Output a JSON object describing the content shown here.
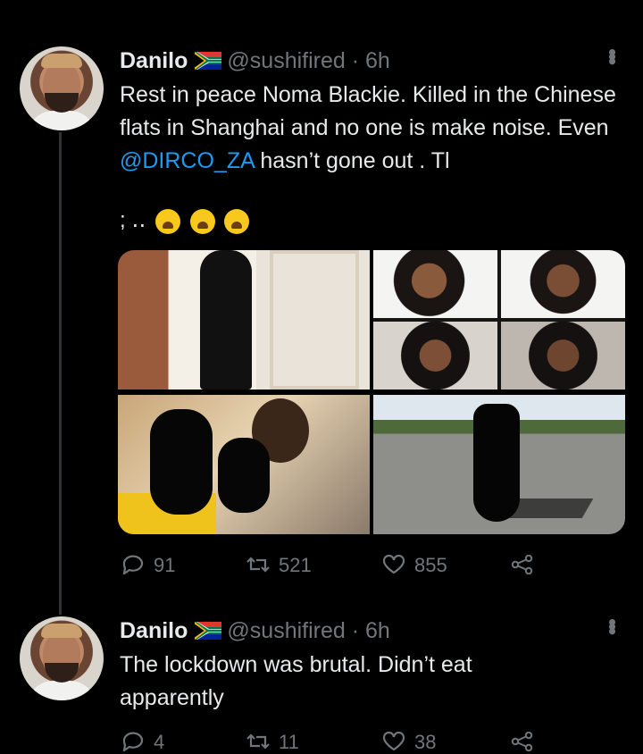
{
  "thread": [
    {
      "author": {
        "name": "Danilo",
        "handle": "@sushifired",
        "flag": "south-africa-flag-icon"
      },
      "separator": "·",
      "time": "6h",
      "text_part1": "Rest in peace Noma Blackie. Killed in the Chinese flats in Shanghai and no one is make noise. Even ",
      "mention": "@DIRCO_ZA",
      "text_part2": " hasn’t gone out . Tl",
      "emoji_line_prefix": ";  ‥",
      "emojis": [
        "loudly-crying-face",
        "loudly-crying-face",
        "loudly-crying-face"
      ],
      "media_count": 4,
      "stats": {
        "replies": "91",
        "retweets": "521",
        "likes": "855"
      }
    },
    {
      "author": {
        "name": "Danilo",
        "handle": "@sushifired",
        "flag": "south-africa-flag-icon"
      },
      "separator": "·",
      "time": "6h",
      "text": "The lockdown was brutal. Didn’t eat apparently",
      "stats": {
        "replies": "4",
        "retweets": "11",
        "likes": "38"
      }
    }
  ],
  "colors": {
    "background": "#000000",
    "text": "#e7e9ea",
    "secondary": "#71767b",
    "link": "#1d9bf0"
  }
}
